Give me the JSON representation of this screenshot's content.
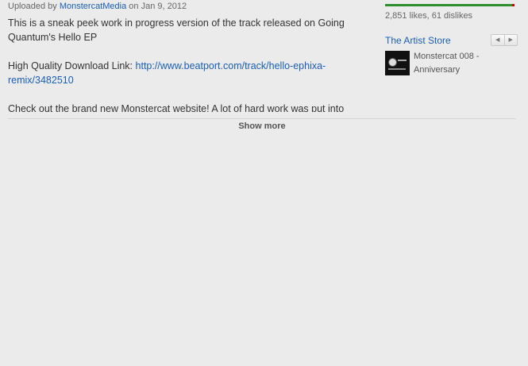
{
  "description": {
    "uploaded_by_prefix": "Uploaded by",
    "uploader": "MonstercatMedia",
    "date_text": "on Jan 9, 2012",
    "para1": "This is a sneak peek work in progress version of the track released on Going Quantum's Hello EP",
    "download_label": "High Quality Download Link:",
    "download_link": "http://www.beatport.com/track/hello-ephixa-remix/3482510",
    "para3": "Check out the brand new Monstercat website! A lot of hard work was put into",
    "show_more": "Show more"
  },
  "ratings": {
    "likes_fraction": 0.979,
    "counts_text": "2,851 likes, 61 dislikes",
    "like_color": "#2d8f2d",
    "dislike_color": "#cc0000"
  },
  "store": {
    "title": "The Artist Store",
    "prev_icon": "chevron-left-icon",
    "next_icon": "chevron-right-icon",
    "item_title": "Monstercat 008 - Anniversary"
  }
}
